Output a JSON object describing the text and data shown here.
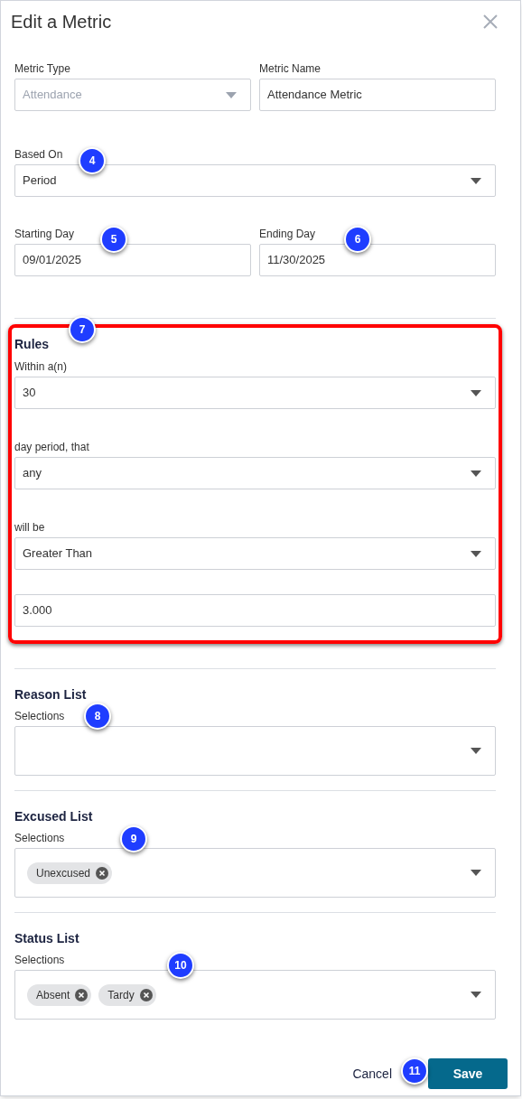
{
  "dialog": {
    "title": "Edit a Metric"
  },
  "metric_type": {
    "label": "Metric Type",
    "value": "Attendance",
    "disabled": true
  },
  "metric_name": {
    "label": "Metric Name",
    "value": "Attendance Metric"
  },
  "based_on": {
    "label": "Based On",
    "value": "Period"
  },
  "starting_day": {
    "label": "Starting Day",
    "value": "09/01/2025"
  },
  "ending_day": {
    "label": "Ending Day",
    "value": "11/30/2025"
  },
  "rules": {
    "title": "Rules",
    "highlighted": true,
    "within": {
      "label": "Within a(n)",
      "value": "30"
    },
    "day_period": {
      "label": "day period, that",
      "value": "any"
    },
    "will_be": {
      "label": "will be",
      "value": "Greater Than"
    },
    "amount": {
      "value": "3.000"
    }
  },
  "lists": [
    {
      "title": "Reason List",
      "label": "Selections"
    },
    {
      "title": "Excused List",
      "label": "Selections",
      "chips": [
        "Unexcused"
      ]
    },
    {
      "title": "Status List",
      "label": "Selections",
      "chips": [
        "Absent",
        "Tardy"
      ]
    }
  ],
  "buttons": {
    "cancel": "Cancel",
    "save": "Save"
  },
  "callouts": [
    "4",
    "5",
    "6",
    "7",
    "8",
    "9",
    "10",
    "11"
  ]
}
